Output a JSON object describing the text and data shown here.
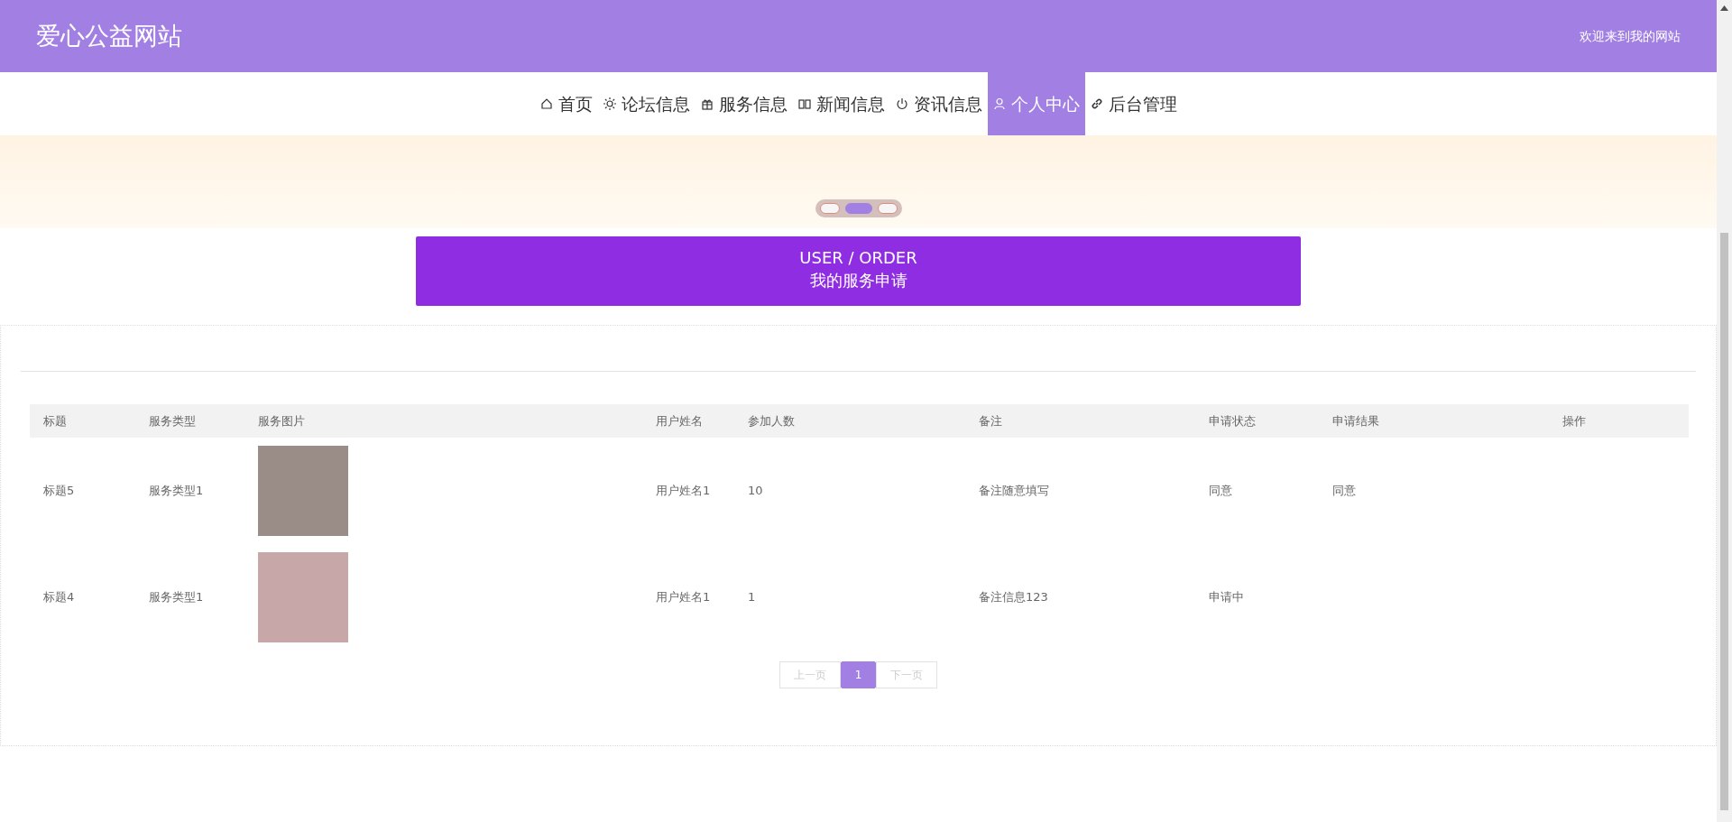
{
  "header": {
    "site_title": "爱心公益网站",
    "welcome": "欢迎来到我的网站"
  },
  "nav": [
    {
      "label": "首页",
      "selected": false,
      "kind": "home"
    },
    {
      "label": "论坛信息",
      "selected": false,
      "kind": "forum"
    },
    {
      "label": "服务信息",
      "selected": false,
      "kind": "service"
    },
    {
      "label": "新闻信息",
      "selected": false,
      "kind": "news"
    },
    {
      "label": "资讯信息",
      "selected": false,
      "kind": "info"
    },
    {
      "label": "个人中心",
      "selected": true,
      "kind": "profile"
    },
    {
      "label": "后台管理",
      "selected": false,
      "kind": "admin"
    }
  ],
  "banner": {
    "dots": [
      {
        "selected": false
      },
      {
        "selected": true
      },
      {
        "selected": false
      }
    ]
  },
  "section_title": {
    "english": "USER / ORDER",
    "chinese": "我的服务申请"
  },
  "table": {
    "columns": [
      "标题",
      "服务类型",
      "服务图片",
      "用户姓名",
      "参加人数",
      "备注",
      "申请状态",
      "申请结果",
      "操作"
    ],
    "rows": [
      {
        "title": "标题5",
        "service_type": "服务类型1",
        "user_name": "用户姓名1",
        "participants": "10",
        "remark": "备注随意填写",
        "status": "同意",
        "result": "同意"
      },
      {
        "title": "标题4",
        "service_type": "服务类型1",
        "user_name": "用户姓名1",
        "participants": "1",
        "remark": "备注信息123",
        "status": "申请中"
      }
    ]
  },
  "pagination": [
    {
      "label": "上一页",
      "disabled": true,
      "selected": false
    },
    {
      "label": "1",
      "disabled": false,
      "selected": true
    },
    {
      "label": "下一页",
      "disabled": true,
      "selected": false
    }
  ]
}
